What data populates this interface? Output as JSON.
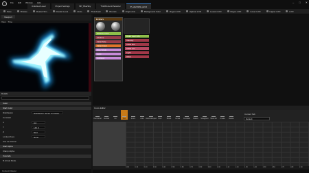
{
  "titlebar": {
    "menu": [
      "File",
      "Edit",
      "Window",
      "Help"
    ],
    "tabs": [
      {
        "label": "Unlocked Level",
        "active": false
      },
      {
        "label": "Project Settings",
        "active": false
      },
      {
        "label": "BP_BlueSky",
        "active": false
      },
      {
        "label": "ThirdPersonCharacter",
        "active": false
      },
      {
        "label": "P_electricity_jam1",
        "active": true
      }
    ],
    "window_controls": [
      "–",
      "□",
      "✕"
    ]
  },
  "toolbar": {
    "items": [
      "Save",
      "Browse",
      "Restart Sim",
      "Restart Level",
      "Undo",
      "Thumbnail",
      "Bounds",
      "Origin Axis",
      "Background Color",
      "Regen LOD",
      "Highest LOD",
      "Lowest LOD",
      "Regen LOD",
      "Lower LOD",
      "Higher LOD",
      "LOD"
    ]
  },
  "viewport": {
    "tab": "Viewport",
    "buttons": [
      "View",
      "Time"
    ]
  },
  "details": {
    "tab": "Details",
    "rows": [
      {
        "label": "Color",
        "type": "cat"
      },
      {
        "label": "Start Color",
        "type": "cat"
      },
      {
        "label": "Distribution",
        "value": "Distribution Vector Constant"
      },
      {
        "label": "Constant",
        "value": ""
      },
      {
        "label": "X",
        "value": "0.0"
      },
      {
        "label": "Y",
        "value": "140.0"
      },
      {
        "label": "Z",
        "value": "50.0"
      },
      {
        "label": "Locked Axes",
        "value": "None"
      },
      {
        "label": "Use as Advanc",
        "value": ""
      },
      {
        "label": "Start Alpha",
        "type": "cat"
      },
      {
        "label": "Clamp Alpha",
        "value": ""
      },
      {
        "label": "Cascade",
        "type": "cat"
      },
      {
        "label": "B Actual Mode",
        "value": ""
      }
    ],
    "footer": "Content Drawer"
  },
  "material_node": {
    "title": "Emitters",
    "pins": [
      {
        "label": "Particle Color",
        "color": "#8fbf4a"
      },
      {
        "label": "Lifetime",
        "color": "#9a3c4a"
      },
      {
        "label": "Initial Size",
        "color": "#9a3c4a"
      },
      {
        "label": "Initial Color",
        "color": "#e0742a"
      },
      {
        "label": "Size Scale",
        "color": "#c98bd9"
      },
      {
        "label": "Light",
        "color": "#c98bd9"
      },
      {
        "label": "Collision",
        "color": "#c98bd9"
      }
    ]
  },
  "node2": {
    "pins": [
      {
        "label": "Color over Life",
        "color": "#8fbf4a"
      },
      {
        "label": "Velocity",
        "color": "#a13848"
      },
      {
        "label": "Initial Rot",
        "color": "#a13848"
      },
      {
        "label": "Initial Loc",
        "color": "#b84a63"
      },
      {
        "label": "Light",
        "color": "#a13848"
      },
      {
        "label": "Orbit",
        "color": "#a13848"
      }
    ]
  },
  "curve_editor": {
    "tab": "Curve Editor",
    "tools": [
      "Horizontal",
      "Vertical",
      "Fit",
      "Pan",
      "Zoom",
      "Auto",
      "Auto/Clamped",
      "User",
      "Break",
      "Linear",
      "Constant",
      "Flatten",
      "Straighten",
      "Show All",
      "Create",
      "Delete"
    ],
    "selected_tool": "Pan",
    "current_tab_label": "Current Tab",
    "current_tab_value": "Default",
    "ruler": [
      "0.00",
      "0.10",
      "0.20",
      "0.30",
      "0.40",
      "0.50",
      "0.60",
      "0.70",
      "0.80",
      "0.90",
      "1.00",
      "1.10",
      "1.20",
      "1.30",
      "1.40",
      "1.50",
      "1.60",
      "1.70",
      "1.80",
      "1.90"
    ]
  },
  "colors": {
    "accent": "#c77a18",
    "emissive": "#7fe8ff"
  }
}
